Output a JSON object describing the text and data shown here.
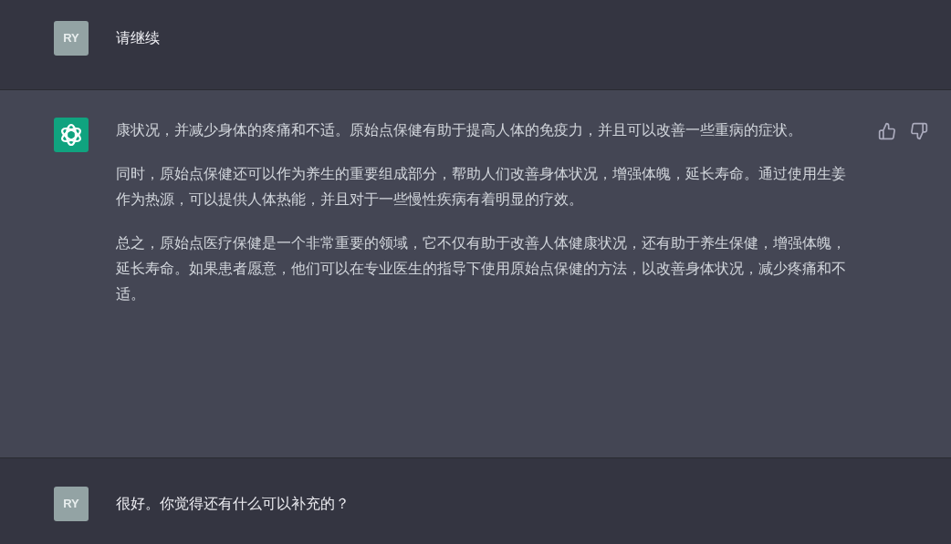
{
  "messages": [
    {
      "kind": "user",
      "avatar": "RY",
      "paragraphs": [
        "请继续"
      ]
    },
    {
      "kind": "assistant",
      "paragraphs": [
        "康状况，并减少身体的疼痛和不适。原始点保健有助于提高人体的免疫力，并且可以改善一些重病的症状。",
        "同时，原始点保健还可以作为养生的重要组成部分，帮助人们改善身体状况，增强体魄，延长寿命。通过使用生姜作为热源，可以提供人体热能，并且对于一些慢性疾病有着明显的疗效。",
        "总之，原始点医疗保健是一个非常重要的领域，它不仅有助于改善人体健康状况，还有助于养生保健，增强体魄，延长寿命。如果患者愿意，他们可以在专业医生的指导下使用原始点保健的方法，以改善身体状况，减少疼痛和不适。"
      ]
    },
    {
      "kind": "user",
      "avatar": "RY",
      "paragraphs": [
        "很好。你觉得还有什么可以补充的？"
      ]
    }
  ]
}
